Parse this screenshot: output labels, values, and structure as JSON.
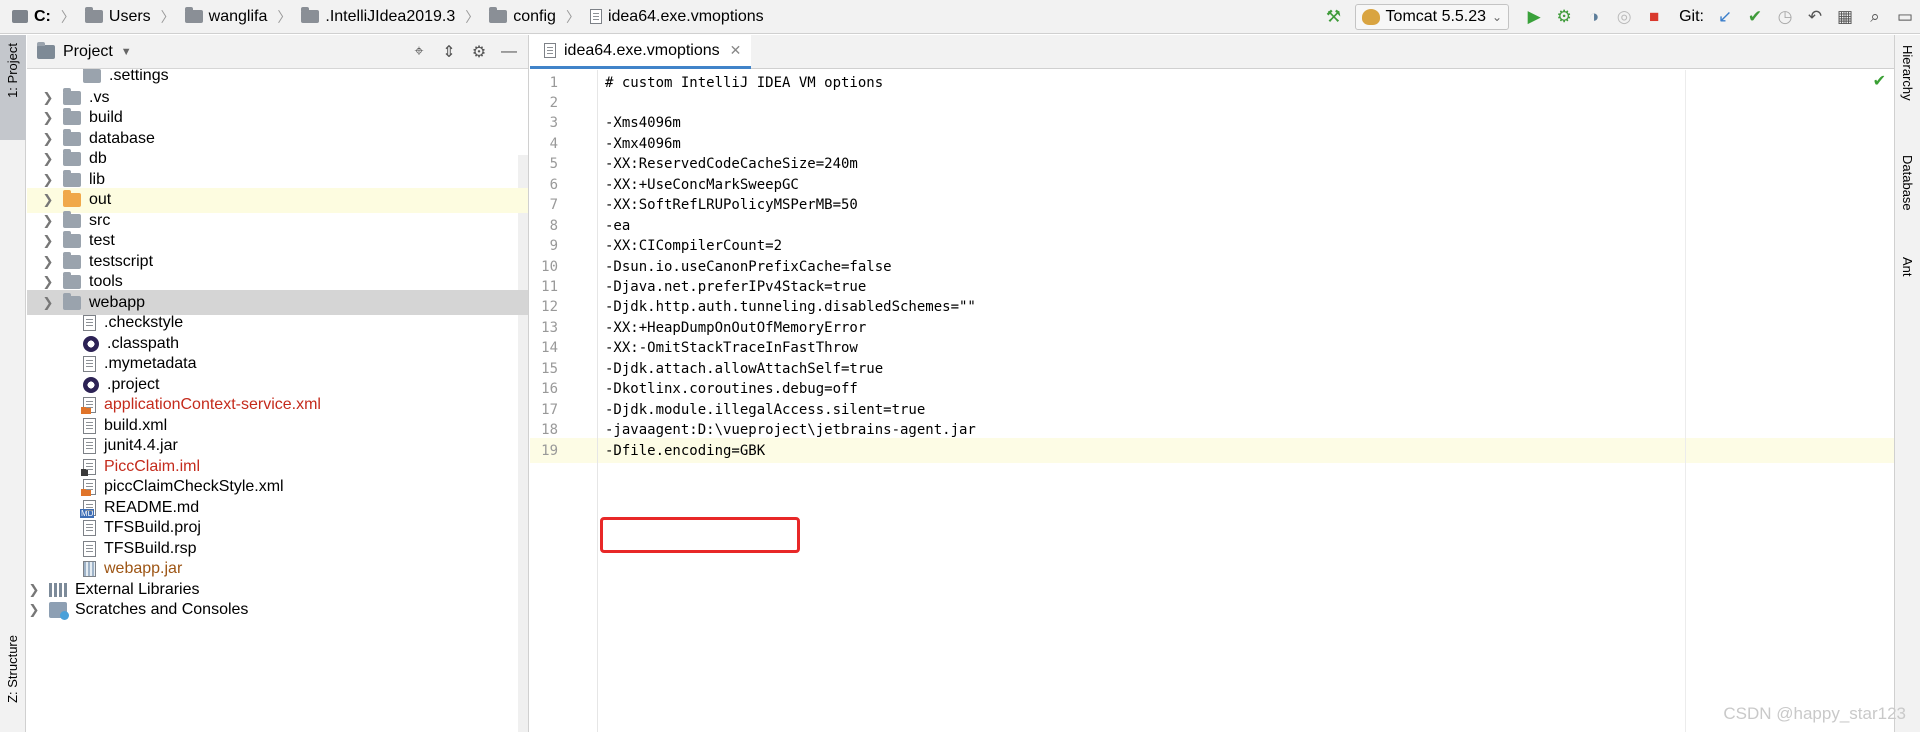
{
  "breadcrumbs": [
    {
      "label": "C:",
      "icon": "drive-icon"
    },
    {
      "label": "Users",
      "icon": "folder-icon"
    },
    {
      "label": "wanglifa",
      "icon": "folder-icon"
    },
    {
      "label": ".IntelliJIdea2019.3",
      "icon": "folder-icon"
    },
    {
      "label": "config",
      "icon": "folder-icon"
    },
    {
      "label": "idea64.exe.vmoptions",
      "icon": "file-icon"
    }
  ],
  "toolbar": {
    "run_config": "Tomcat 5.5.23",
    "git_label": "Git:"
  },
  "left_strip": {
    "project_tab": "1: Project",
    "structure_tab": "Z: Structure"
  },
  "right_strip": {
    "hierarchy": "Hierarchy",
    "database": "Database",
    "ant": "Ant"
  },
  "project_panel": {
    "title": "Project",
    "partial_top": ".settings",
    "items": [
      {
        "label": ".vs",
        "type": "folder"
      },
      {
        "label": "build",
        "type": "folder"
      },
      {
        "label": "database",
        "type": "folder"
      },
      {
        "label": "db",
        "type": "folder"
      },
      {
        "label": "lib",
        "type": "folder"
      },
      {
        "label": "out",
        "type": "folder-orange"
      },
      {
        "label": "src",
        "type": "folder"
      },
      {
        "label": "test",
        "type": "folder"
      },
      {
        "label": "testscript",
        "type": "folder"
      },
      {
        "label": "tools",
        "type": "folder"
      },
      {
        "label": "webapp",
        "type": "folder-web"
      },
      {
        "label": ".checkstyle",
        "type": "file"
      },
      {
        "label": ".classpath",
        "type": "eclipse"
      },
      {
        "label": ".mymetadata",
        "type": "file"
      },
      {
        "label": ".project",
        "type": "eclipse"
      },
      {
        "label": "applicationContext-service.xml",
        "type": "xml"
      },
      {
        "label": "build.xml",
        "type": "file"
      },
      {
        "label": "junit4.4.jar",
        "type": "file"
      },
      {
        "label": "PiccClaim.iml",
        "type": "iml"
      },
      {
        "label": "piccClaimCheckStyle.xml",
        "type": "xml"
      },
      {
        "label": "README.md",
        "type": "md"
      },
      {
        "label": "TFSBuild.proj",
        "type": "file"
      },
      {
        "label": "TFSBuild.rsp",
        "type": "file"
      },
      {
        "label": "webapp.jar",
        "type": "jar"
      }
    ],
    "external_libraries": "External Libraries",
    "scratches": "Scratches and Consoles"
  },
  "editor": {
    "tab_label": "idea64.exe.vmoptions",
    "lines": [
      "# custom IntelliJ IDEA VM options",
      "",
      "-Xms4096m",
      "-Xmx4096m",
      "-XX:ReservedCodeCacheSize=240m",
      "-XX:+UseConcMarkSweepGC",
      "-XX:SoftRefLRUPolicyMSPerMB=50",
      "-ea",
      "-XX:CICompilerCount=2",
      "-Dsun.io.useCanonPrefixCache=false",
      "-Djava.net.preferIPv4Stack=true",
      "-Djdk.http.auth.tunneling.disabledSchemes=\"\"",
      "-XX:+HeapDumpOnOutOfMemoryError",
      "-XX:-OmitStackTraceInFastThrow",
      "-Djdk.attach.allowAttachSelf=true",
      "-Dkotlinx.coroutines.debug=off",
      "-Djdk.module.illegalAccess.silent=true",
      "-javaagent:D:\\vueproject\\jetbrains-agent.jar",
      "-Dfile.encoding=GBK"
    ],
    "current_line": 19
  },
  "watermark": "CSDN @happy_star123"
}
